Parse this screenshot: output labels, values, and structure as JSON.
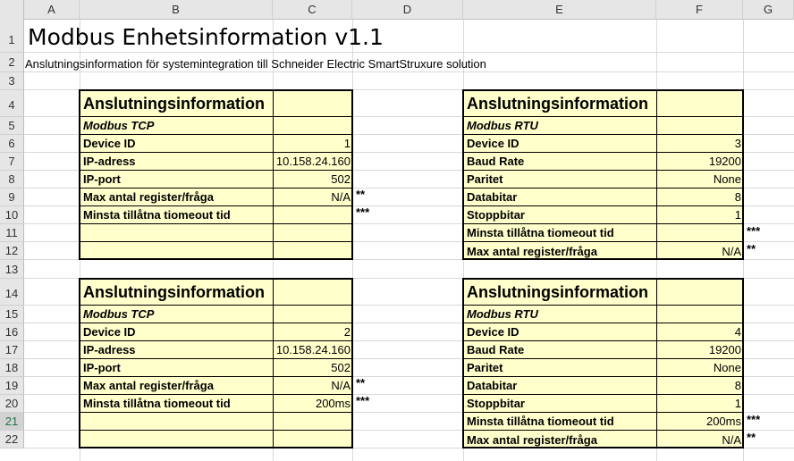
{
  "columns": [
    "A",
    "B",
    "C",
    "D",
    "E",
    "F",
    "G"
  ],
  "rows": [
    "1",
    "2",
    "3",
    "4",
    "5",
    "6",
    "7",
    "8",
    "9",
    "10",
    "11",
    "12",
    "13",
    "14",
    "15",
    "16",
    "17",
    "18",
    "19",
    "20",
    "21",
    "22"
  ],
  "sheet": {
    "title": "Modbus Enhetsinformation v1.1",
    "subtitle": "Anslutningsinformation för systemintegration till Schneider Electric SmartStruxure solution"
  },
  "panels": [
    {
      "heading": "Anslutningsinformation",
      "protocol": "Modbus TCP",
      "rows": [
        {
          "label": "Device ID",
          "value": "1",
          "note": ""
        },
        {
          "label": "IP-adress",
          "value": "10.158.24.160",
          "note": ""
        },
        {
          "label": "IP-port",
          "value": "502",
          "note": ""
        },
        {
          "label": "Max antal register/fråga",
          "value": "N/A",
          "note": "**"
        },
        {
          "label": "Minsta tillåtna tiomeout tid",
          "value": "",
          "note": "***"
        },
        {
          "label": "",
          "value": "",
          "note": ""
        },
        {
          "label": "",
          "value": "",
          "note": ""
        }
      ]
    },
    {
      "heading": "Anslutningsinformation",
      "protocol": "Modbus RTU",
      "rows": [
        {
          "label": "Device ID",
          "value": "3",
          "note": ""
        },
        {
          "label": "Baud Rate",
          "value": "19200",
          "note": ""
        },
        {
          "label": "Paritet",
          "value": "None",
          "note": ""
        },
        {
          "label": "Databitar",
          "value": "8",
          "note": ""
        },
        {
          "label": "Stoppbitar",
          "value": "1",
          "note": ""
        },
        {
          "label": "Minsta tillåtna tiomeout tid",
          "value": "",
          "note": "***"
        },
        {
          "label": "Max antal register/fråga",
          "value": "N/A",
          "note": "**"
        }
      ]
    },
    {
      "heading": "Anslutningsinformation",
      "protocol": "Modbus TCP",
      "rows": [
        {
          "label": "Device ID",
          "value": "2",
          "note": ""
        },
        {
          "label": "IP-adress",
          "value": "10.158.24.160",
          "note": ""
        },
        {
          "label": "IP-port",
          "value": "502",
          "note": ""
        },
        {
          "label": "Max antal register/fråga",
          "value": "N/A",
          "note": "**"
        },
        {
          "label": "Minsta tillåtna tiomeout tid",
          "value": "200ms",
          "note": "***"
        },
        {
          "label": "",
          "value": "",
          "note": ""
        },
        {
          "label": "",
          "value": "",
          "note": ""
        }
      ]
    },
    {
      "heading": "Anslutningsinformation",
      "protocol": "Modbus RTU",
      "rows": [
        {
          "label": "Device ID",
          "value": "4",
          "note": ""
        },
        {
          "label": "Baud Rate",
          "value": "19200",
          "note": ""
        },
        {
          "label": "Paritet",
          "value": "None",
          "note": ""
        },
        {
          "label": "Databitar",
          "value": "8",
          "note": ""
        },
        {
          "label": "Stoppbitar",
          "value": "1",
          "note": ""
        },
        {
          "label": "Minsta tillåtna tiomeout tid",
          "value": "200ms",
          "note": "***"
        },
        {
          "label": "Max antal register/fråga",
          "value": "N/A",
          "note": "**"
        }
      ]
    }
  ],
  "colors": {
    "panel_fill": "#ffffcc",
    "header_bg": "#e6e6e6",
    "active_row": "#217346"
  }
}
